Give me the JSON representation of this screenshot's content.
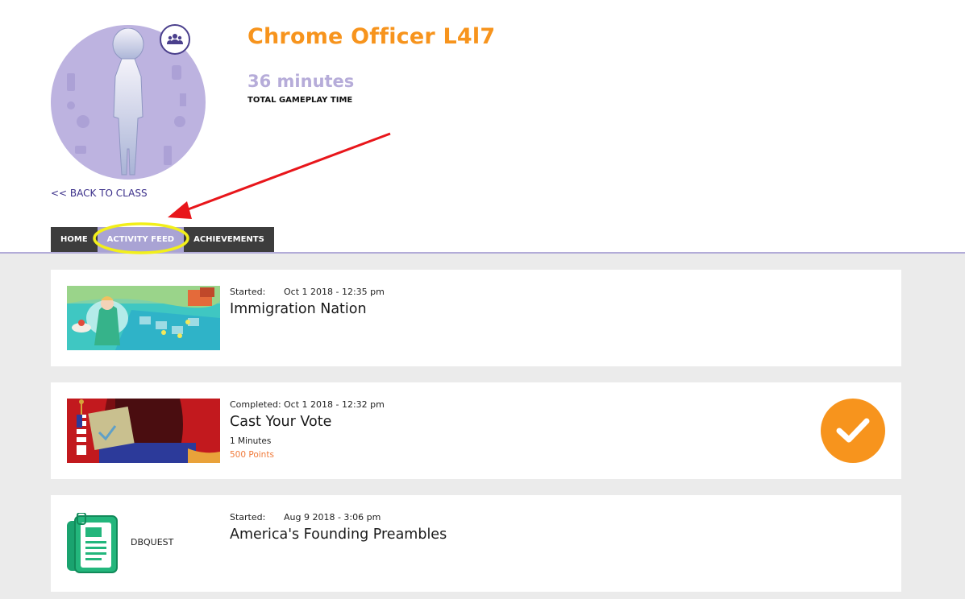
{
  "player": {
    "name": "Chrome Officer L4l7",
    "gameplay_time": "36 minutes",
    "gameplay_label": "TOTAL GAMEPLAY TIME",
    "back_link": "<< BACK TO CLASS",
    "group_icon": "group-icon"
  },
  "tabs": [
    {
      "label": "HOME",
      "active": false
    },
    {
      "label": "ACTIVITY FEED",
      "active": true
    },
    {
      "label": "ACHIEVEMENTS",
      "active": false
    }
  ],
  "feed": [
    {
      "status_label": "Started:",
      "date": "Oct 1 2018 - 12:35 pm",
      "title": "Immigration Nation",
      "thumbnail": "immigration-nation-thumbnail"
    },
    {
      "status_label": "Completed:",
      "date": "Oct 1 2018 - 12:32 pm",
      "title": "Cast Your Vote",
      "minutes": "1 Minutes",
      "points": "500 Points",
      "thumbnail": "cast-your-vote-thumbnail",
      "completed_icon": "checkmark-icon"
    },
    {
      "status_label": "Started:",
      "date": "Aug 9 2018 - 3:06 pm",
      "title": "America's Founding Preambles",
      "type_label": "DBQUEST",
      "thumbnail": "dbquest-document-icon"
    }
  ],
  "colors": {
    "accent": "#f7941d",
    "lavender": "#b6acd9",
    "tab_dark": "#3d3d3d",
    "tab_active": "#a9a3d4",
    "link": "#3b2f8a"
  },
  "annotation": {
    "arrow_color": "#e8161b",
    "highlight_color": "#f2ef1a"
  }
}
